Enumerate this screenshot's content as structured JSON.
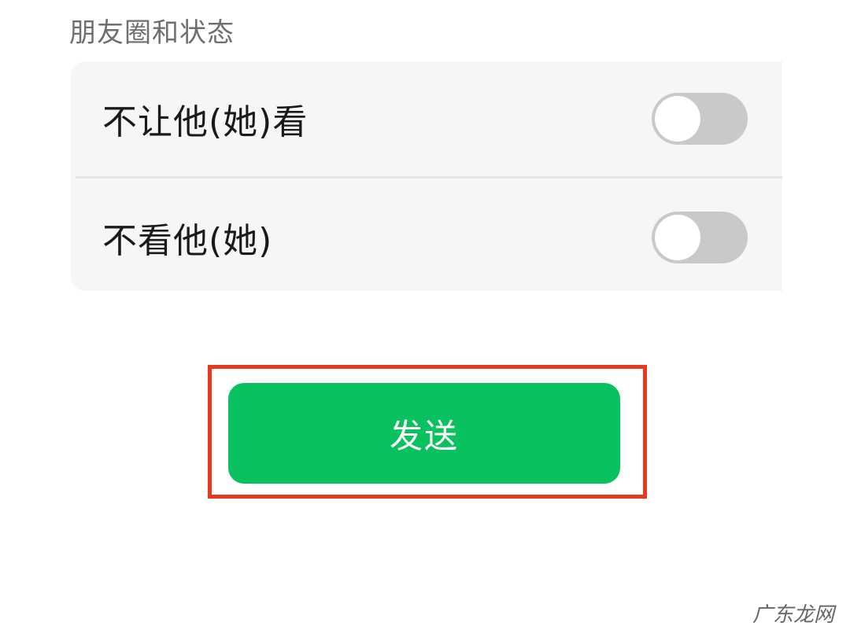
{
  "section": {
    "title": "朋友圈和状态"
  },
  "settings": [
    {
      "label": "不让他(她)看",
      "enabled": false
    },
    {
      "label": "不看他(她)",
      "enabled": false
    }
  ],
  "actions": {
    "send_label": "发送"
  },
  "watermark": "广东龙网",
  "colors": {
    "send_button": "#0ac160",
    "highlight_frame": "#e8381f",
    "toggle_off": "#c9c9c9",
    "card_background": "#f6f6f6"
  }
}
